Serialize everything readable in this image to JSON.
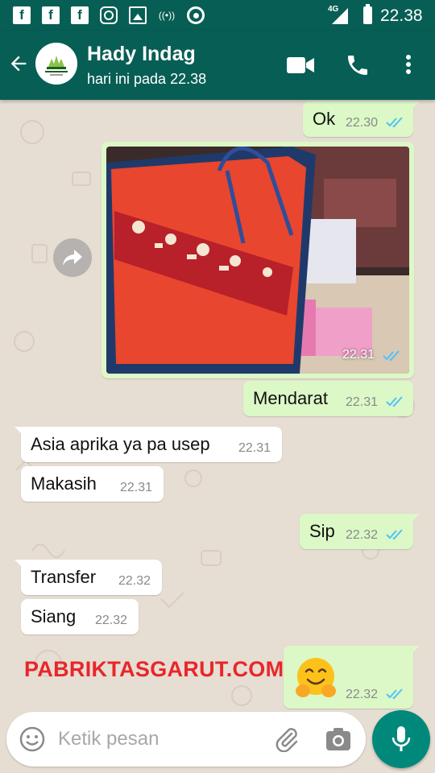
{
  "status_bar": {
    "time": "22.38",
    "network": "4G"
  },
  "header": {
    "contact_name": "Hady Indag",
    "last_seen": "hari ini pada 22.38"
  },
  "messages": [
    {
      "direction": "out",
      "text": "Ok",
      "time": "22.30",
      "read": true
    },
    {
      "direction": "out",
      "type": "image",
      "time": "22.31",
      "read": true
    },
    {
      "direction": "out",
      "text": "Mendarat",
      "time": "22.31",
      "read": true
    },
    {
      "direction": "in",
      "text": "Asia aprika ya pa usep",
      "time": "22.31"
    },
    {
      "direction": "in",
      "text": "Makasih",
      "time": "22.31"
    },
    {
      "direction": "out",
      "text": "Sip",
      "time": "22.32",
      "read": true
    },
    {
      "direction": "in",
      "text": "Transfer",
      "time": "22.32"
    },
    {
      "direction": "in",
      "text": "Siang",
      "time": "22.32"
    },
    {
      "direction": "out",
      "type": "emoji",
      "emoji": "hugging-face",
      "time": "22.32",
      "read": true
    }
  ],
  "watermark": "PABRIKTASGARUT.COM",
  "composer": {
    "placeholder": "Ketik pesan"
  },
  "colors": {
    "header": "#075e54",
    "outgoing_bubble": "#dcf8c6",
    "incoming_bubble": "#ffffff",
    "read_ticks": "#4fc3f7",
    "mic_button": "#00897b",
    "watermark": "#e8262a"
  }
}
